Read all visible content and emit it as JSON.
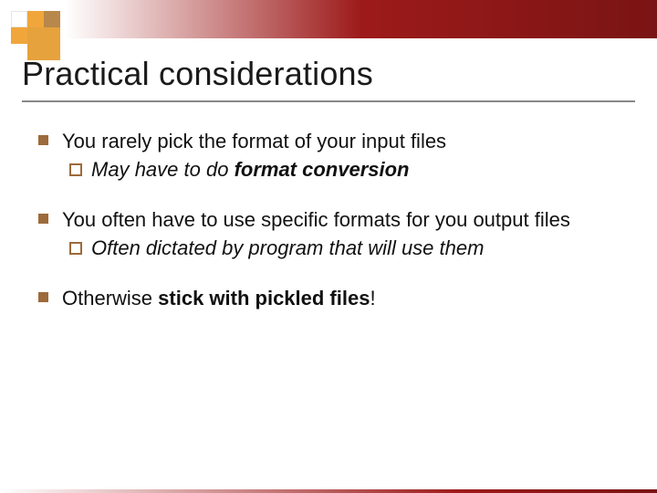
{
  "title": "Practical considerations",
  "bullets": {
    "b1": {
      "text": "You rarely pick the format of your input files",
      "sub_lead": "May ",
      "sub_mid": "have to do ",
      "sub_bold": "format conversion"
    },
    "b2": {
      "text": "You often have to use specific formats for you output files",
      "sub_lead": "Often ",
      "sub_rest": "dictated by program that will use them"
    },
    "b3": {
      "lead": "Otherwise ",
      "bold": "stick with pickled files",
      "tail": "!"
    }
  }
}
